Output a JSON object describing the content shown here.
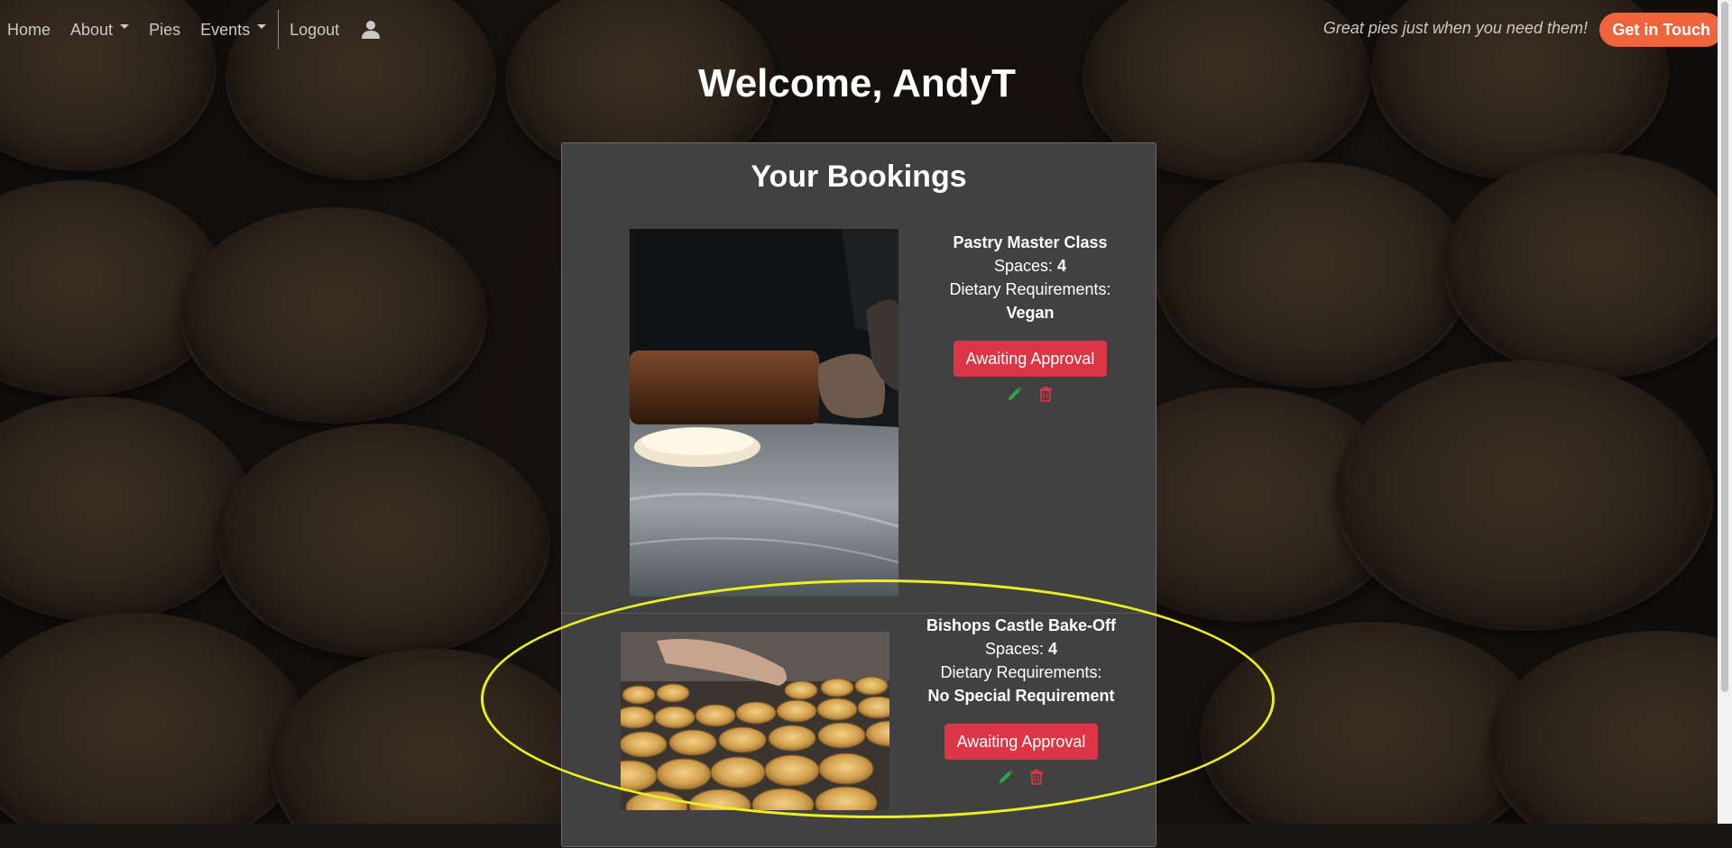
{
  "nav": {
    "items": [
      {
        "label": "Home",
        "dropdown": false
      },
      {
        "label": "About",
        "dropdown": true
      },
      {
        "label": "Pies",
        "dropdown": false
      },
      {
        "label": "Events",
        "dropdown": true
      }
    ],
    "logout_label": "Logout",
    "user_icon": "user-icon",
    "tagline": "Great pies just when you need them!",
    "cta_label": "Get in Touch"
  },
  "welcome": "Welcome, AndyT",
  "bookings": {
    "title": "Your Bookings",
    "spaces_label": "Spaces:",
    "dietary_label": "Dietary Requirements:",
    "items": [
      {
        "event": "Pastry Master Class",
        "spaces": "4",
        "dietary": "Vegan",
        "status": "Awaiting Approval",
        "image": "rolling-pin-dough-photo"
      },
      {
        "event": "Bishops Castle Bake-Off",
        "spaces": "4",
        "dietary": "No Special Requirement",
        "status": "Awaiting Approval",
        "image": "tray-of-pies-photo"
      }
    ]
  },
  "colors": {
    "cta": "#f0643d",
    "status": "#dc3545",
    "edit": "#28a745",
    "delete": "#dc3545",
    "highlight": "#ecef1f"
  }
}
